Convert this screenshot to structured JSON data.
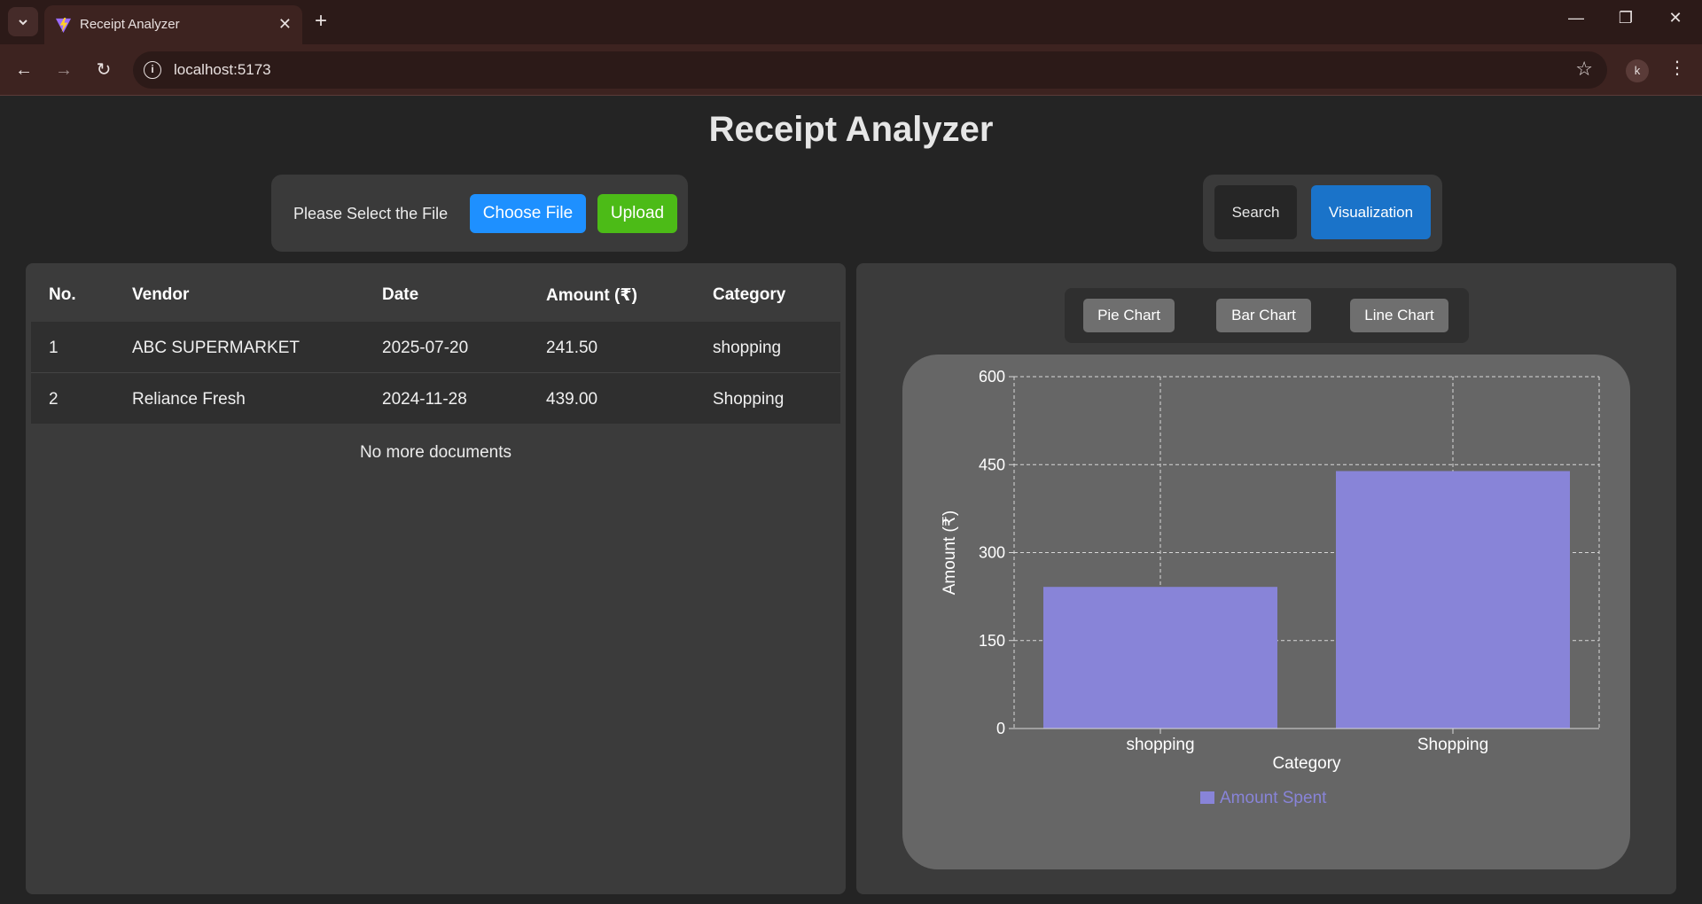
{
  "browser": {
    "tab_title": "Receipt Analyzer",
    "url": "localhost:5173",
    "profile_initial": "k"
  },
  "app": {
    "title": "Receipt Analyzer"
  },
  "upload": {
    "label": "Please Select the File",
    "choose_label": "Choose File",
    "upload_label": "Upload"
  },
  "view_toggle": {
    "search_label": "Search",
    "visualization_label": "Visualization",
    "active": "Visualization"
  },
  "table": {
    "headers": [
      "No.",
      "Vendor",
      "Date",
      "Amount (₹)",
      "Category"
    ],
    "rows": [
      {
        "no": "1",
        "vendor": "ABC SUPERMARKET",
        "date": "2025-07-20",
        "amount": "241.50",
        "category": "shopping"
      },
      {
        "no": "2",
        "vendor": "Reliance Fresh",
        "date": "2024-11-28",
        "amount": "439.00",
        "category": "Shopping"
      }
    ],
    "footer": "No more documents"
  },
  "chart_switch": {
    "pie_label": "Pie Chart",
    "bar_label": "Bar Chart",
    "line_label": "Line Chart"
  },
  "chart_data": {
    "type": "bar",
    "categories": [
      "shopping",
      "Shopping"
    ],
    "series": [
      {
        "name": "Amount Spent",
        "values": [
          241.5,
          439
        ]
      }
    ],
    "xlabel": "Category",
    "ylabel": "Amount (₹)",
    "ylim": [
      0,
      600
    ],
    "yticks": [
      0,
      150,
      300,
      450,
      600
    ],
    "grid": true,
    "legend": "bottom",
    "bar_color": "#8884d8"
  },
  "colors": {
    "choose_button": "#1e90ff",
    "upload_button": "#4cbb17",
    "visualization_button": "#1a73c9"
  }
}
